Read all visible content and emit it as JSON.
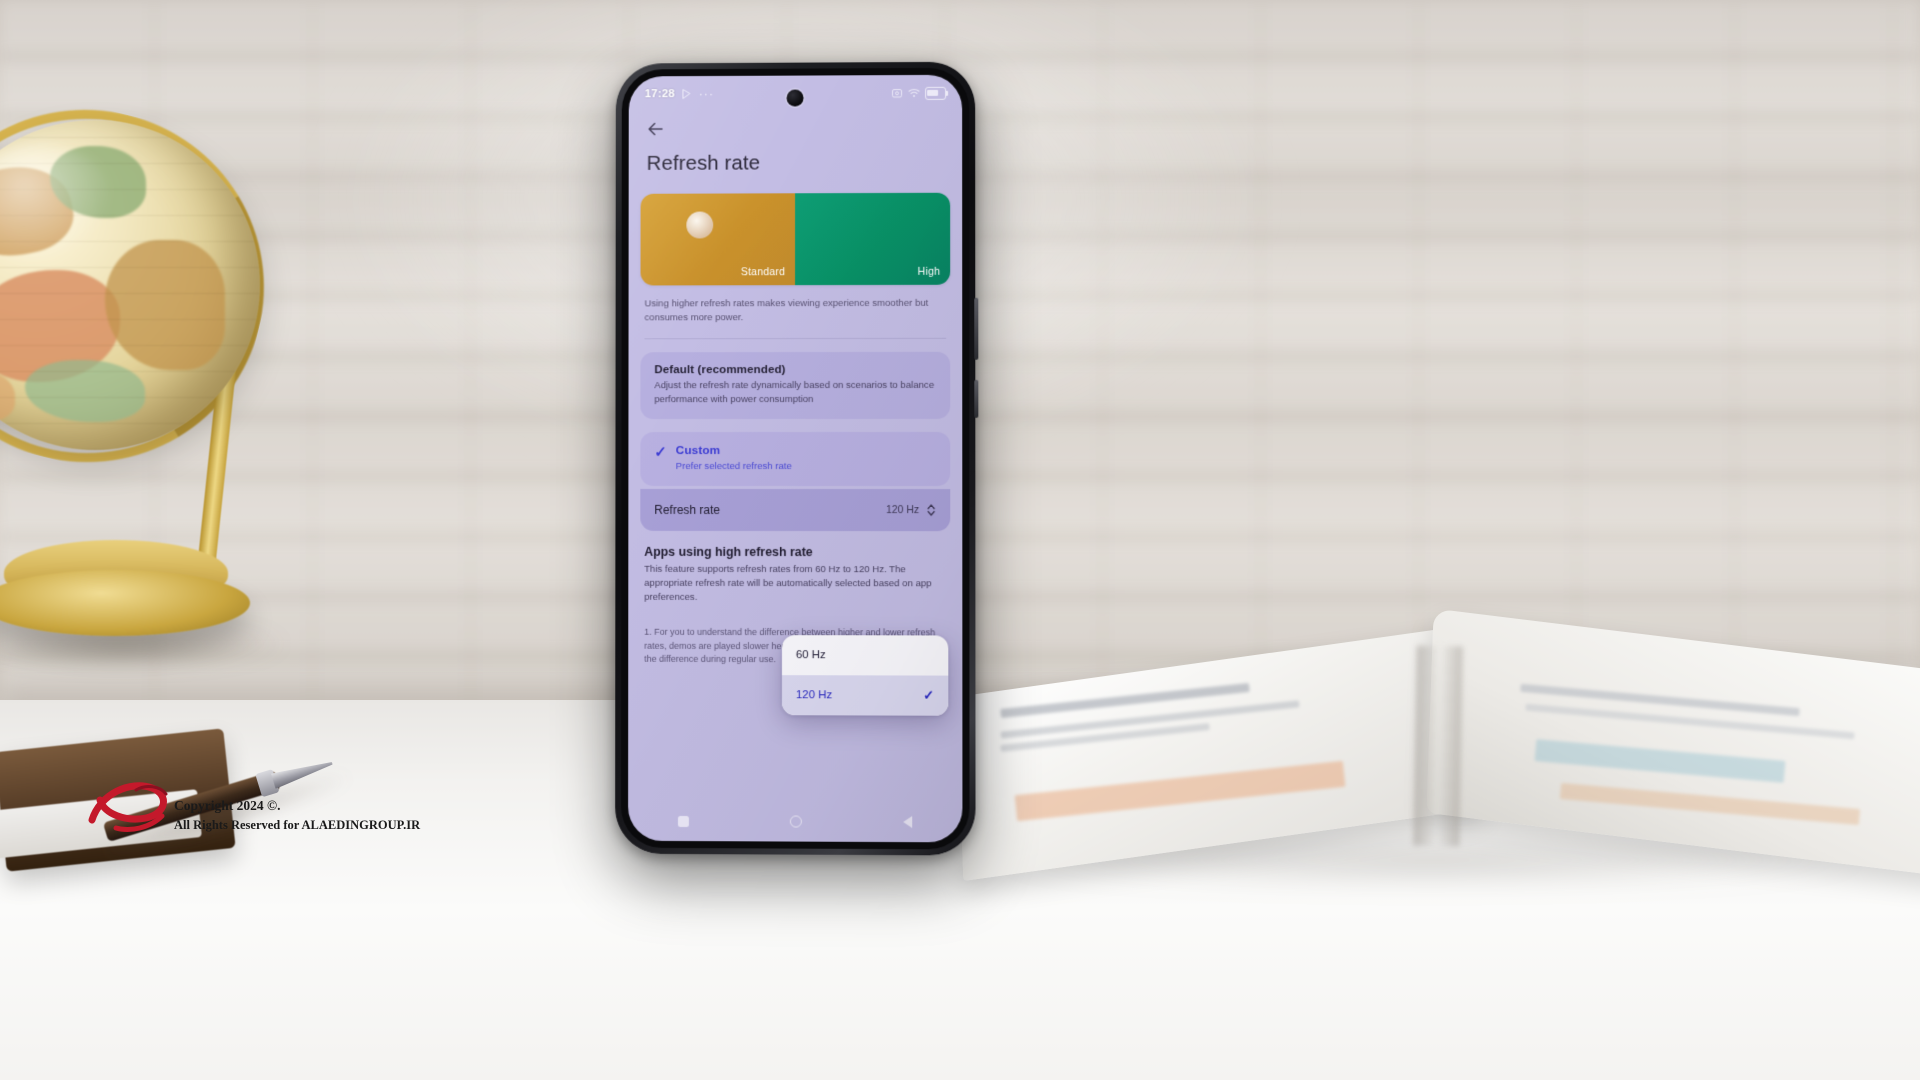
{
  "phone": {
    "status_bar": {
      "time": "17:28",
      "left_icons": [
        "play-triangle-icon",
        "more-dots-icon"
      ],
      "dots": "···",
      "right_icons": [
        "screenshot-icon",
        "wifi-icon",
        "battery-icon"
      ]
    },
    "nav_bar": {
      "recents": "recents-square-icon",
      "home": "home-circle-icon",
      "back": "back-triangle-icon"
    }
  },
  "screen": {
    "back_button": "back-arrow-icon",
    "title": "Refresh rate",
    "demo_cards": [
      {
        "label": "Standard",
        "color": "#c9912b",
        "name": "standard-demo-card"
      },
      {
        "label": "High",
        "color": "#089166",
        "name": "high-demo-card"
      }
    ],
    "demo_note": "Using higher refresh rates makes viewing experience smoother but consumes more power.",
    "options": [
      {
        "title": "Default (recommended)",
        "subtitle": "Adjust the refresh rate dynamically based on scenarios to balance performance with power consumption",
        "selected": false
      },
      {
        "title": "Custom",
        "subtitle": "Prefer selected refresh rate",
        "selected": true,
        "check": "✓"
      }
    ],
    "refresh_rate_row": {
      "label": "Refresh rate",
      "value": "120 Hz"
    },
    "dropdown": {
      "open": true,
      "items": [
        {
          "label": "60 Hz",
          "selected": false
        },
        {
          "label": "120 Hz",
          "selected": true,
          "check": "✓"
        }
      ]
    },
    "apps_section": {
      "title": "Apps using high refresh rate",
      "body": "This feature supports refresh rates from 60 Hz to 120 Hz. The appropriate refresh rate will be automatically selected based on app preferences."
    },
    "footnote": "1. For you to understand the difference between higher and lower refresh rates, demos are played slower here. It might be harder for you to notice the difference during regular use.",
    "colors": {
      "background": "#c3bde4",
      "accent_blue": "#3a3ad4",
      "standard_card": "#c9912b",
      "high_card": "#089166"
    }
  },
  "watermark": {
    "line1": "Copyright 2024 ©.",
    "line2": "All Rights Reserved for ALAEDINGROUP.IR"
  }
}
